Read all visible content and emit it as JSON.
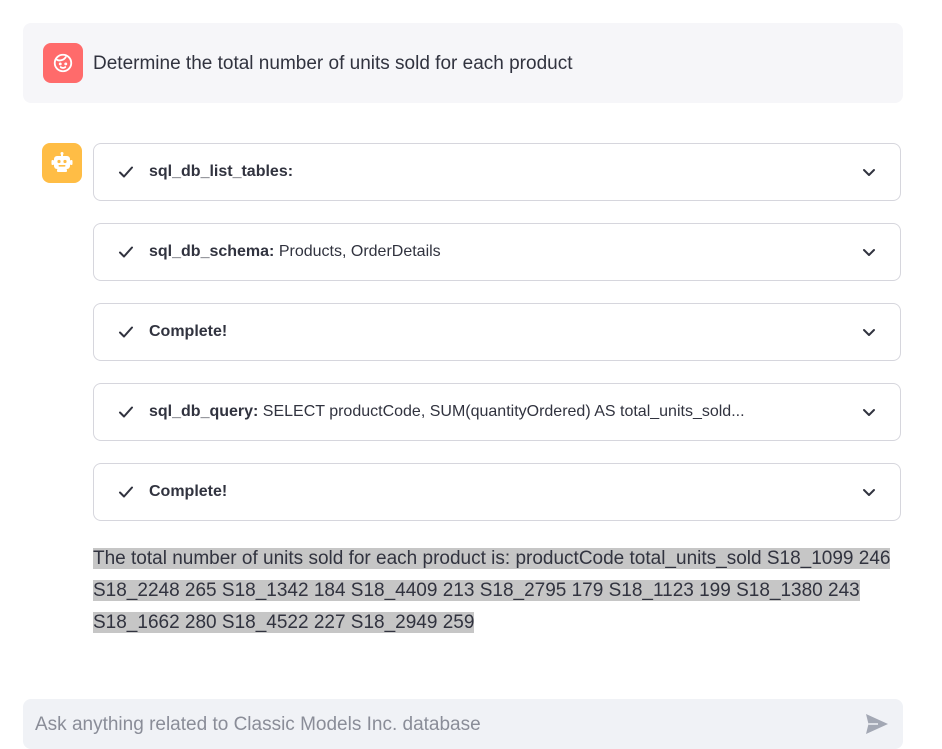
{
  "user_message": {
    "avatar_icon": "user-face-icon",
    "avatar_color": "#ff6b6b",
    "text": "Determine the total number of units sold for each product"
  },
  "assistant": {
    "avatar_icon": "robot-icon",
    "avatar_color": "#ffbd45",
    "steps": [
      {
        "title": "sql_db_list_tables:",
        "detail": ""
      },
      {
        "title": "sql_db_schema:",
        "detail": " Products, OrderDetails"
      },
      {
        "title": "Complete!",
        "detail": ""
      },
      {
        "title": "sql_db_query:",
        "detail": " SELECT productCode, SUM(quantityOrdered) AS total_units_sold..."
      },
      {
        "title": "Complete!",
        "detail": ""
      }
    ],
    "answer": "The total number of units sold for each product is: productCode total_units_sold S18_1099 246 S18_2248 265 S18_1342 184 S18_4409 213 S18_2795 179 S18_1123 199 S18_1380 243 S18_1662 280 S18_4522 227 S18_2949 259"
  },
  "chat_input": {
    "placeholder": "Ask anything related to Classic Models Inc. database",
    "value": ""
  }
}
